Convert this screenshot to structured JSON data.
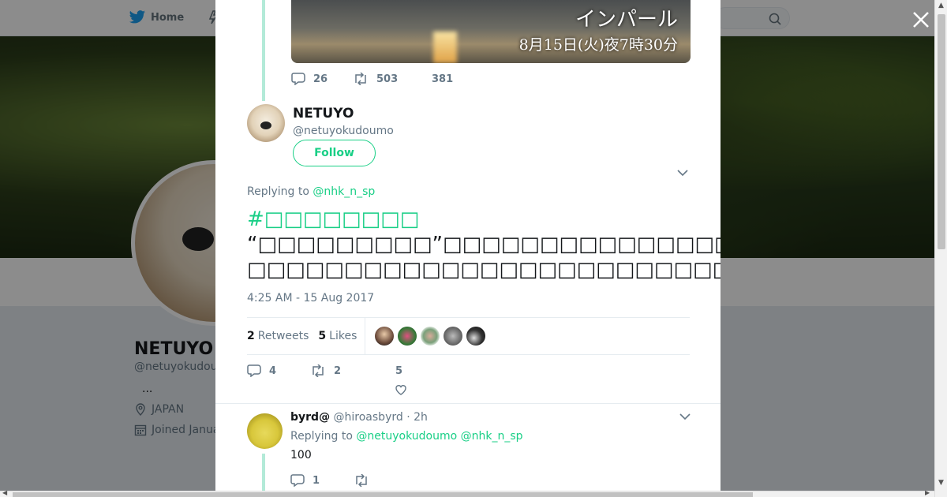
{
  "nav": {
    "home_label": "Home"
  },
  "profile": {
    "name": "NETUYO",
    "handle": "@netuyokudou",
    "bio": "...",
    "location": "JAPAN",
    "joined": "Joined Janua"
  },
  "parent_tweet": {
    "media_title": "インパール",
    "media_subtitle": "8月15日(火)夜7時30分",
    "replies": "26",
    "retweets": "503",
    "likes": "381"
  },
  "tweet": {
    "author_name": "NETUYO",
    "author_handle": "@netuyokudoumo",
    "follow_label": "Follow",
    "replying_prefix": "Replying to",
    "replying_mention": "@nhk_n_sp",
    "hashtag": "#□□□□□□□□",
    "line1": "“□□□□□□□□□”□□□□□□□□□□□□□□□□□□□□□□□□□□□□□□□□□□□□□□□□□□□□□□□□□□",
    "line2": "□□□□□□□□□□□□□□□□□□□□□□□□□□□□□□□□□□□□□□□□□□□□□□□HK□□□□□□□□□□□□□□□",
    "time": "4:25 AM - 15 Aug 2017",
    "retweet_count": "2",
    "retweet_label": "Retweets",
    "like_count": "5",
    "like_label": "Likes",
    "replies": "4",
    "retweets": "2",
    "likes": "5"
  },
  "reply": {
    "name": "byrd@",
    "handle": "@hiroasbyrd",
    "time": "· 2h",
    "replying_prefix": "Replying to",
    "mention1": "@netuyokudoumo",
    "mention2": "@nhk_n_sp",
    "text": "100",
    "replies": "1"
  },
  "colors": {
    "accent": "#19cf86",
    "text": "#14171a",
    "muted": "#657786"
  },
  "icons": [
    "twitter-bird-icon",
    "search-icon",
    "close-icon",
    "reply-icon",
    "retweet-icon",
    "heart-icon",
    "chevron-down-icon",
    "location-icon",
    "calendar-icon"
  ]
}
